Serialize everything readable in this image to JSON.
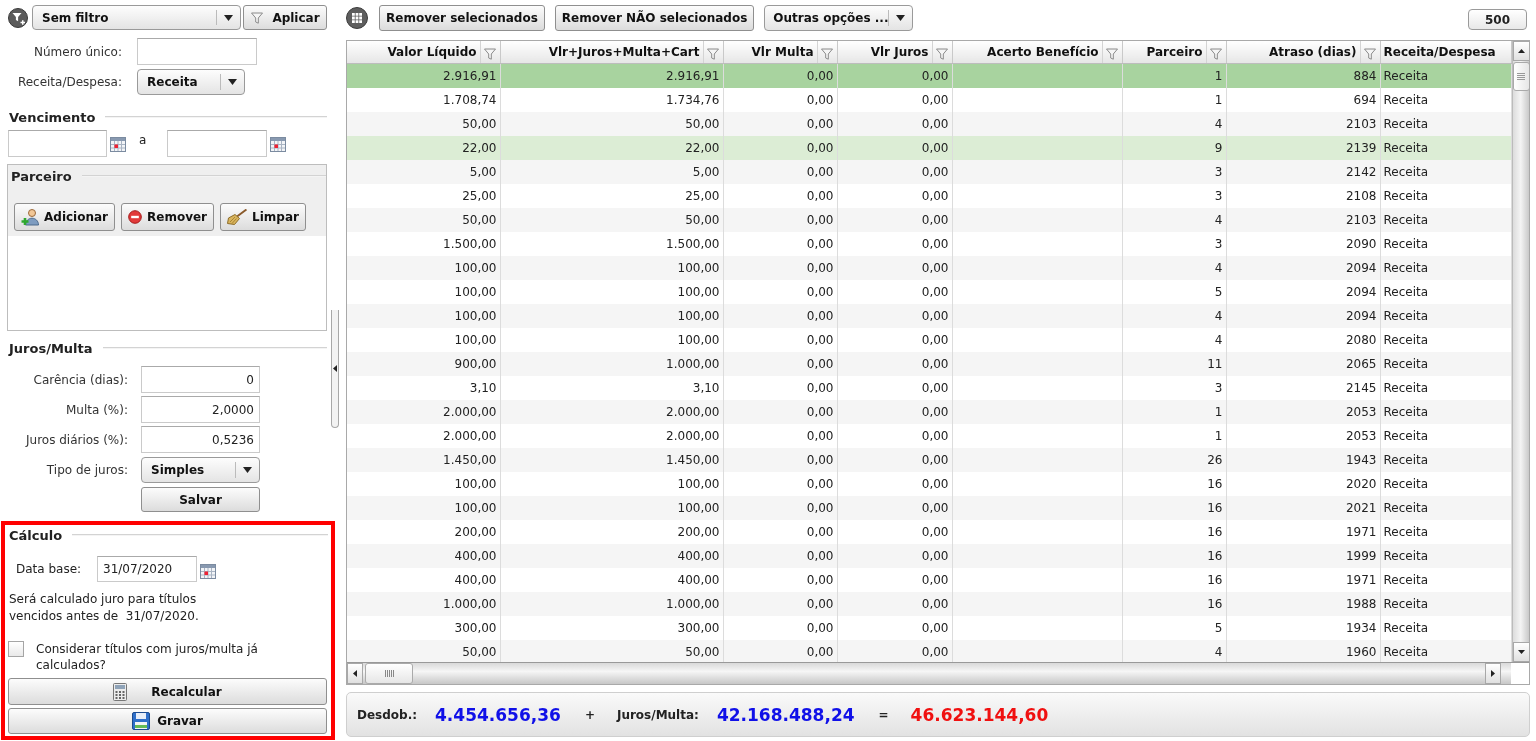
{
  "filter_bar": {
    "filter": "Sem filtro",
    "apply_button": "Aplicar"
  },
  "fields": [
    {
      "label": "Número único:",
      "kind": "input"
    },
    {
      "label": "Receita/Despesa:",
      "kind": "select",
      "value": "Receita"
    }
  ],
  "vencimento": {
    "title": "Vencimento",
    "separator": "a"
  },
  "parceiro": {
    "title": "Parceiro",
    "buttons": [
      "Adicionar",
      "Remover",
      "Limpar"
    ]
  },
  "juros_multa": {
    "title": "Juros/Multa",
    "fields": [
      {
        "label": "Carência (dias):",
        "kind": "input",
        "value": "0"
      },
      {
        "label": "Multa (%):",
        "kind": "input",
        "value": "2,0000"
      },
      {
        "label": "Juros diários (%):",
        "kind": "input",
        "value": "0,5236"
      },
      {
        "label": "Tipo de juros:",
        "kind": "select",
        "value": "Simples"
      }
    ],
    "save_button": "Salvar"
  },
  "calculo": {
    "title": "Cálculo",
    "highlighted": true,
    "base_date_label": "Data base:",
    "base_date": "31/07/2020",
    "note": "Será calculado juro para títulos vencidos antes de  31/07/2020.",
    "consider_checkbox": {
      "label": "Considerar títulos com juros/multa já calculados?",
      "checked": false
    },
    "buttons": [
      "Recalcular",
      "Gravar"
    ]
  },
  "toolbar": {
    "buttons": [
      "Remover selecionados",
      "Remover NÃO selecionados"
    ],
    "options_menu": "Outras opções ...",
    "record_count": "500"
  },
  "table": {
    "columns": [
      {
        "label": "Valor Líquido",
        "kind": "number",
        "filterable": true
      },
      {
        "label": "Vlr+Juros+Multa+Cart",
        "kind": "number",
        "filterable": true
      },
      {
        "label": "Vlr Multa",
        "kind": "number",
        "filterable": true
      },
      {
        "label": "Vlr Juros",
        "kind": "number",
        "filterable": true
      },
      {
        "label": "Acerto Benefício",
        "kind": "number",
        "filterable": true
      },
      {
        "label": "Parceiro",
        "kind": "number",
        "filterable": true
      },
      {
        "label": "Atraso (dias)",
        "kind": "number",
        "filterable": true
      },
      {
        "label": "Receita/Despesa",
        "kind": "text",
        "filterable": false
      }
    ],
    "rows": [
      {
        "cells": [
          "2.916,91",
          "2.916,91",
          "0,00",
          "0,00",
          "",
          "1",
          "884",
          "Receita"
        ],
        "selected": true,
        "focused": true
      },
      {
        "cells": [
          "1.708,74",
          "1.734,76",
          "0,00",
          "0,00",
          "",
          "1",
          "694",
          "Receita"
        ],
        "selected": false,
        "focused": false
      },
      {
        "cells": [
          "50,00",
          "50,00",
          "0,00",
          "0,00",
          "",
          "4",
          "2103",
          "Receita"
        ],
        "selected": false,
        "focused": false
      },
      {
        "cells": [
          "22,00",
          "22,00",
          "0,00",
          "0,00",
          "",
          "9",
          "2139",
          "Receita"
        ],
        "selected": true,
        "focused": false
      },
      {
        "cells": [
          "5,00",
          "5,00",
          "0,00",
          "0,00",
          "",
          "3",
          "2142",
          "Receita"
        ],
        "selected": false,
        "focused": false
      },
      {
        "cells": [
          "25,00",
          "25,00",
          "0,00",
          "0,00",
          "",
          "3",
          "2108",
          "Receita"
        ],
        "selected": false,
        "focused": false
      },
      {
        "cells": [
          "50,00",
          "50,00",
          "0,00",
          "0,00",
          "",
          "4",
          "2103",
          "Receita"
        ],
        "selected": false,
        "focused": false
      },
      {
        "cells": [
          "1.500,00",
          "1.500,00",
          "0,00",
          "0,00",
          "",
          "3",
          "2090",
          "Receita"
        ],
        "selected": false,
        "focused": false
      },
      {
        "cells": [
          "100,00",
          "100,00",
          "0,00",
          "0,00",
          "",
          "4",
          "2094",
          "Receita"
        ],
        "selected": false,
        "focused": false
      },
      {
        "cells": [
          "100,00",
          "100,00",
          "0,00",
          "0,00",
          "",
          "5",
          "2094",
          "Receita"
        ],
        "selected": false,
        "focused": false
      },
      {
        "cells": [
          "100,00",
          "100,00",
          "0,00",
          "0,00",
          "",
          "4",
          "2094",
          "Receita"
        ],
        "selected": false,
        "focused": false
      },
      {
        "cells": [
          "100,00",
          "100,00",
          "0,00",
          "0,00",
          "",
          "4",
          "2080",
          "Receita"
        ],
        "selected": false,
        "focused": false
      },
      {
        "cells": [
          "900,00",
          "1.000,00",
          "0,00",
          "0,00",
          "",
          "11",
          "2065",
          "Receita"
        ],
        "selected": false,
        "focused": false
      },
      {
        "cells": [
          "3,10",
          "3,10",
          "0,00",
          "0,00",
          "",
          "3",
          "2145",
          "Receita"
        ],
        "selected": false,
        "focused": false
      },
      {
        "cells": [
          "2.000,00",
          "2.000,00",
          "0,00",
          "0,00",
          "",
          "1",
          "2053",
          "Receita"
        ],
        "selected": false,
        "focused": false
      },
      {
        "cells": [
          "2.000,00",
          "2.000,00",
          "0,00",
          "0,00",
          "",
          "1",
          "2053",
          "Receita"
        ],
        "selected": false,
        "focused": false
      },
      {
        "cells": [
          "1.450,00",
          "1.450,00",
          "0,00",
          "0,00",
          "",
          "26",
          "1943",
          "Receita"
        ],
        "selected": false,
        "focused": false
      },
      {
        "cells": [
          "100,00",
          "100,00",
          "0,00",
          "0,00",
          "",
          "16",
          "2020",
          "Receita"
        ],
        "selected": false,
        "focused": false
      },
      {
        "cells": [
          "100,00",
          "100,00",
          "0,00",
          "0,00",
          "",
          "16",
          "2021",
          "Receita"
        ],
        "selected": false,
        "focused": false
      },
      {
        "cells": [
          "200,00",
          "200,00",
          "0,00",
          "0,00",
          "",
          "16",
          "1971",
          "Receita"
        ],
        "selected": false,
        "focused": false
      },
      {
        "cells": [
          "400,00",
          "400,00",
          "0,00",
          "0,00",
          "",
          "16",
          "1999",
          "Receita"
        ],
        "selected": false,
        "focused": false
      },
      {
        "cells": [
          "400,00",
          "400,00",
          "0,00",
          "0,00",
          "",
          "16",
          "1971",
          "Receita"
        ],
        "selected": false,
        "focused": false
      },
      {
        "cells": [
          "1.000,00",
          "1.000,00",
          "0,00",
          "0,00",
          "",
          "16",
          "1988",
          "Receita"
        ],
        "selected": false,
        "focused": false
      },
      {
        "cells": [
          "300,00",
          "300,00",
          "0,00",
          "0,00",
          "",
          "5",
          "1934",
          "Receita"
        ],
        "selected": false,
        "focused": false
      },
      {
        "cells": [
          "50,00",
          "50,00",
          "0,00",
          "0,00",
          "",
          "4",
          "1960",
          "Receita"
        ],
        "selected": false,
        "focused": false
      }
    ]
  },
  "totals": [
    {
      "kind": "label",
      "text": "Desdob.:"
    },
    {
      "kind": "amount",
      "text": "4.454.656,36",
      "color": "#1010e8"
    },
    {
      "kind": "operator",
      "text": "+"
    },
    {
      "kind": "label",
      "text": "Juros/Multa:"
    },
    {
      "kind": "amount",
      "text": "42.168.488,24",
      "color": "#1010e8"
    },
    {
      "kind": "operator",
      "text": "="
    },
    {
      "kind": "amount",
      "text": "46.623.144,60",
      "color": "#f01010"
    }
  ]
}
